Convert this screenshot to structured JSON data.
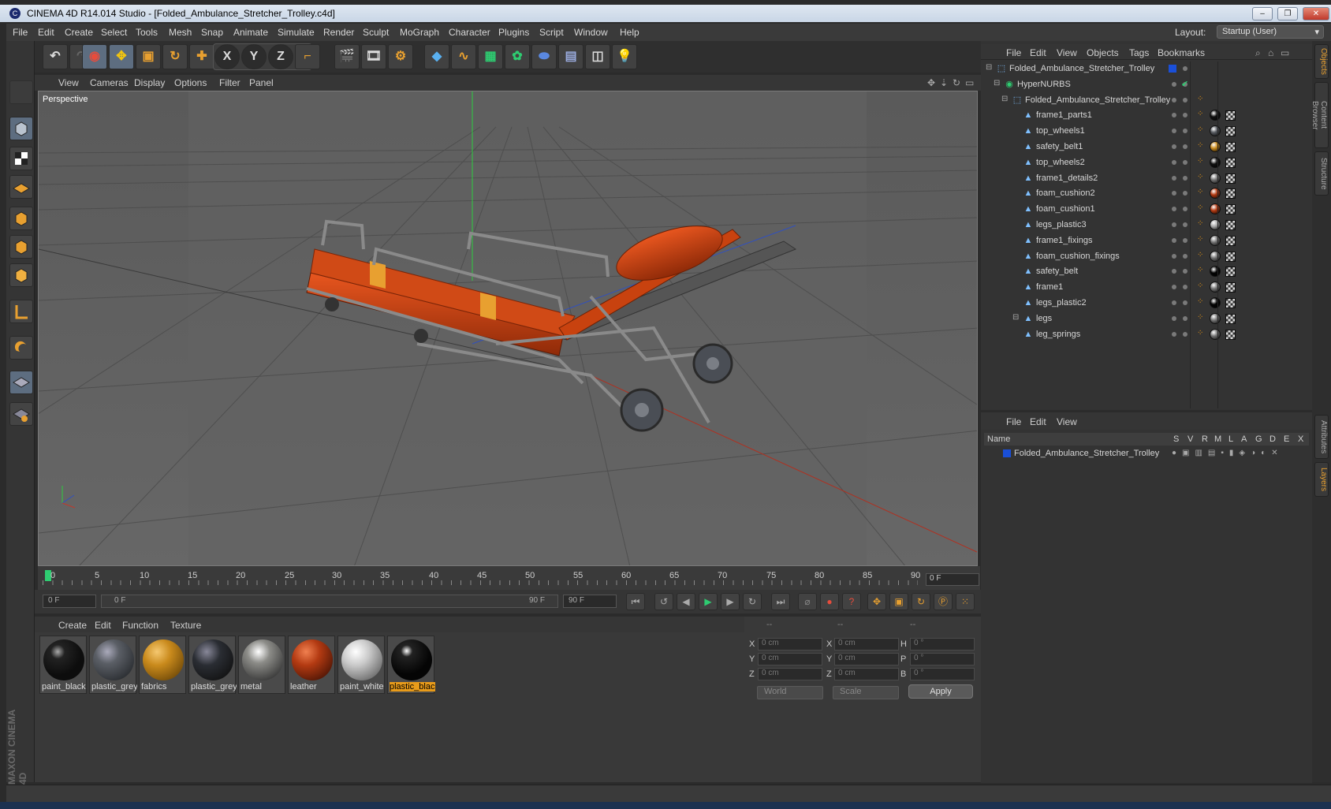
{
  "window": {
    "title": "CINEMA 4D R14.014 Studio - [Folded_Ambulance_Stretcher_Trolley.c4d]",
    "buttons": {
      "minimize": "–",
      "restore": "❐",
      "close": "✕"
    }
  },
  "menubar": {
    "items": [
      "File",
      "Edit",
      "Create",
      "Select",
      "Tools",
      "Mesh",
      "Snap",
      "Animate",
      "Simulate",
      "Render",
      "Sculpt",
      "MoGraph",
      "Character",
      "Plugins",
      "Script",
      "Window",
      "Help"
    ],
    "layout_label": "Layout:",
    "layout_value": "Startup (User)"
  },
  "viewport": {
    "menu": [
      "View",
      "Cameras",
      "Display",
      "Options",
      "Filter",
      "Panel"
    ],
    "label": "Perspective"
  },
  "timeline": {
    "ticks": [
      "0",
      "5",
      "10",
      "15",
      "20",
      "25",
      "30",
      "35",
      "40",
      "45",
      "50",
      "55",
      "60",
      "65",
      "70",
      "75",
      "80",
      "85",
      "90"
    ],
    "current_frame": "0 F"
  },
  "transport": {
    "start": "0 F",
    "range_start": "0 F",
    "range_end": "90 F",
    "end": "90 F"
  },
  "materials": {
    "menu": [
      "Create",
      "Edit",
      "Function",
      "Texture"
    ],
    "items": [
      {
        "label": "paint_black",
        "color": "#0d0d0d"
      },
      {
        "label": "plastic_grey",
        "color": "#5b5f66"
      },
      {
        "label": "fabrics",
        "color": "#c98a1c"
      },
      {
        "label": "plastic_grey",
        "color": "#2a2d33"
      },
      {
        "label": "metal",
        "color": "#8c8c88"
      },
      {
        "label": "leather",
        "color": "#b33a12"
      },
      {
        "label": "paint_white",
        "color": "#c9c9c9"
      },
      {
        "label": "plastic_black",
        "color": "#050505"
      }
    ],
    "selected_index": 7
  },
  "coordinates": {
    "headers": [
      "--",
      "--",
      "--"
    ],
    "rows": [
      {
        "a": "X",
        "av": "0 cm",
        "b": "X",
        "bv": "0 cm",
        "c": "H",
        "cv": "0 °"
      },
      {
        "a": "Y",
        "av": "0 cm",
        "b": "Y",
        "bv": "0 cm",
        "c": "P",
        "cv": "0 °"
      },
      {
        "a": "Z",
        "av": "0 cm",
        "b": "Z",
        "bv": "0 cm",
        "c": "B",
        "cv": "0 °"
      }
    ],
    "world": "World",
    "scale": "Scale",
    "apply": "Apply"
  },
  "objects": {
    "menu": [
      "File",
      "Edit",
      "View",
      "Objects",
      "Tags",
      "Bookmarks"
    ],
    "tree": [
      {
        "name": "Folded_Ambulance_Stretcher_Trolley",
        "level": 0,
        "kind": "null"
      },
      {
        "name": "HyperNURBS",
        "level": 1,
        "kind": "nurbs"
      },
      {
        "name": "Folded_Ambulance_Stretcher_Trolley",
        "level": 2,
        "kind": "null"
      },
      {
        "name": "frame1_parts1",
        "level": 3,
        "kind": "poly",
        "mat": "#111"
      },
      {
        "name": "top_wheels1",
        "level": 3,
        "kind": "poly",
        "mat": "#55595f"
      },
      {
        "name": "safety_belt1",
        "level": 3,
        "kind": "poly",
        "mat": "#c98a1c"
      },
      {
        "name": "top_wheels2",
        "level": 3,
        "kind": "poly",
        "mat": "#111"
      },
      {
        "name": "frame1_details2",
        "level": 3,
        "kind": "poly",
        "mat": "#777"
      },
      {
        "name": "foam_cushion2",
        "level": 3,
        "kind": "poly",
        "mat": "#b33a12"
      },
      {
        "name": "foam_cushion1",
        "level": 3,
        "kind": "poly",
        "mat": "#b33a12"
      },
      {
        "name": "legs_plastic3",
        "level": 3,
        "kind": "poly",
        "mat": "#aaa"
      },
      {
        "name": "frame1_fixings",
        "level": 3,
        "kind": "poly",
        "mat": "#777"
      },
      {
        "name": "foam_cushion_fixings",
        "level": 3,
        "kind": "poly",
        "mat": "#777"
      },
      {
        "name": "safety_belt",
        "level": 3,
        "kind": "poly",
        "mat": "#050505"
      },
      {
        "name": "frame1",
        "level": 3,
        "kind": "poly",
        "mat": "#777"
      },
      {
        "name": "legs_plastic2",
        "level": 3,
        "kind": "poly",
        "mat": "#050505"
      },
      {
        "name": "legs",
        "level": 3,
        "kind": "poly",
        "mat": "#777"
      },
      {
        "name": "leg_springs",
        "level": 3,
        "kind": "poly",
        "mat": "#777"
      }
    ]
  },
  "layers": {
    "menu": [
      "File",
      "Edit",
      "View"
    ],
    "columns": [
      "Name",
      "S",
      "V",
      "R",
      "M",
      "L",
      "A",
      "G",
      "D",
      "E",
      "X"
    ],
    "row": "Folded_Ambulance_Stretcher_Trolley"
  },
  "right_tabs": [
    "Objects",
    "Content Browser",
    "Structure",
    "Attributes",
    "Layers"
  ],
  "brand": "MAXON CINEMA 4D",
  "colors": {
    "accent": "#e89b1a",
    "axis_x": "#c0392b",
    "axis_y": "#2ecc40",
    "selected_blue": "#1a4fd8"
  }
}
